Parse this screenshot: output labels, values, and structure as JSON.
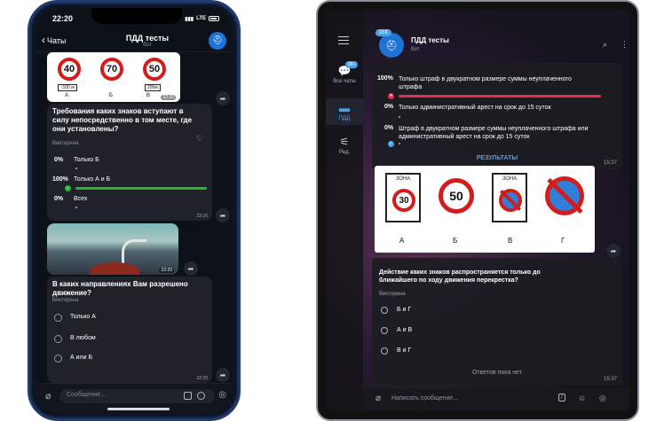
{
  "phone": {
    "status": {
      "time": "22:20",
      "network": "LTE"
    },
    "header": {
      "back_label": "Чаты",
      "title": "ПДД тесты",
      "subtitle": "бот"
    },
    "signs_message": {
      "signs": [
        {
          "value": "40",
          "plate": "↑100 м",
          "letter": "А"
        },
        {
          "value": "70",
          "plate": "",
          "letter": "Б"
        },
        {
          "value": "50",
          "plate": "200м",
          "letter": "В"
        }
      ],
      "time": "22:20"
    },
    "quiz1": {
      "question": "Требования каких знаков вступают в силу непосредственно в том месте, где они установлены?",
      "type": "Викторина",
      "options": [
        {
          "percent": "0%",
          "label": "Только Б",
          "fill": 0
        },
        {
          "percent": "100%",
          "label": "Только А и Б",
          "fill": 1
        },
        {
          "percent": "0%",
          "label": "Всех",
          "fill": 0
        }
      ],
      "time": "22:20"
    },
    "photo_message": {
      "time": "22:20"
    },
    "quiz2": {
      "question": "В каких направлениях Вам разрешено движение?",
      "type": "Викторина",
      "options": [
        "Только А",
        "В любом",
        "А или Б"
      ],
      "time": "22:20"
    },
    "input": {
      "placeholder": "Сообщение..."
    }
  },
  "tablet": {
    "sidebar": {
      "all_chats": {
        "label": "Все чаты",
        "badge": "99+"
      },
      "pdd": {
        "label": "ПДД"
      },
      "edit": {
        "label": "Ред."
      }
    },
    "header": {
      "title": "ПДД тесты",
      "subtitle": "бот",
      "unread": "118"
    },
    "poll_result": {
      "options": [
        {
          "percent": "100%",
          "text": "Только штраф в двукратном размере суммы неуплаченного штрафа",
          "fill": 1
        },
        {
          "percent": "0%",
          "text": "Только административный арест на срок до 15 суток",
          "fill": 0
        },
        {
          "percent": "0%",
          "text": "Штраф в двукратном размере суммы неуплаченного штрафа или административный арест на срок до 15 суток",
          "fill": 0
        }
      ],
      "results_button": "РЕЗУЛЬТАТЫ",
      "time": "15:37"
    },
    "signs_message": {
      "zone_label": "ЗОНА",
      "signs": [
        {
          "value": "30",
          "letter": "А"
        },
        {
          "value": "50",
          "letter": "Б"
        },
        {
          "value": "",
          "letter": "В"
        },
        {
          "value": "",
          "letter": "Г"
        }
      ]
    },
    "quiz": {
      "question": "Действие каких знаков распространяется только до ближайшего по ходу движения перекрестка?",
      "type": "Викторина",
      "options": [
        "Б и Г",
        "А и В",
        "В и Г"
      ],
      "no_answers": "Ответов пока нет",
      "time": "15:37"
    },
    "input": {
      "placeholder": "Написать сообщение..."
    }
  },
  "colors": {
    "accent_green": "#25b82f",
    "accent_red": "#e5304a",
    "accent_blue": "#4aa2ea",
    "sign_red": "#d51c1c"
  }
}
